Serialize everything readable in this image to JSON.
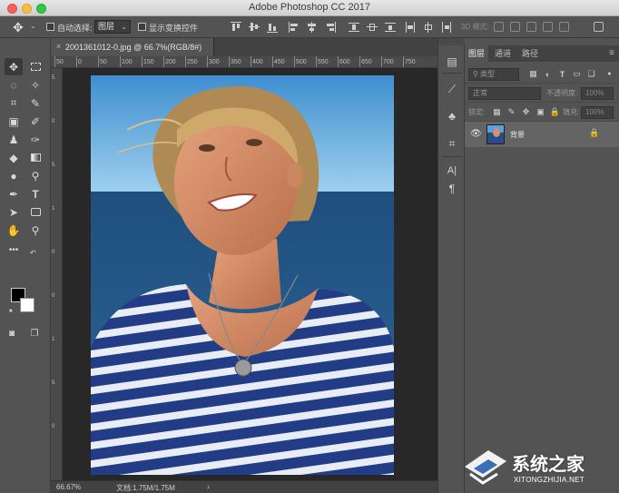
{
  "window": {
    "title": "Adobe Photoshop CC 2017"
  },
  "options_bar": {
    "auto_select_label": "自动选择:",
    "auto_select_value": "图层",
    "show_transform_label": "显示变换控件",
    "mode_3d_label": "3D 模式:",
    "move_icon": "move-icon"
  },
  "document": {
    "tab_close": "×",
    "tab_title": "2001361012-0.jpg @ 66.7%(RGB/8#)",
    "ruler_ticks": [
      "50",
      "0",
      "50",
      "100",
      "150",
      "200",
      "250",
      "300",
      "350",
      "400",
      "450",
      "500",
      "550",
      "600",
      "650",
      "700",
      "750"
    ],
    "ruler_ticks_v": [
      "5",
      "0",
      "5",
      "1",
      "0",
      "0",
      "1",
      "5",
      "0"
    ]
  },
  "status": {
    "zoom": "66.67%",
    "doc_info": "文档:1.75M/1.75M",
    "arrow": "›"
  },
  "panel": {
    "tabs": [
      "图层",
      "通道",
      "路径"
    ],
    "active_tab": "图层",
    "filter_kind": "类型",
    "blend_mode": "正常",
    "opacity_label": "不透明度:",
    "opacity_value": "100%",
    "lock_label": "锁定:",
    "fill_label": "填充:",
    "fill_value": "100%",
    "layers": [
      {
        "name": "背景",
        "visible": true,
        "locked": true
      }
    ]
  },
  "watermark": {
    "text": "系统之家",
    "url": "XITONGZHIJIA.NET"
  },
  "colors": {
    "foreground": "#000000",
    "background": "#ffffff",
    "panel_bg": "#535353",
    "canvas_bg": "#282828"
  }
}
